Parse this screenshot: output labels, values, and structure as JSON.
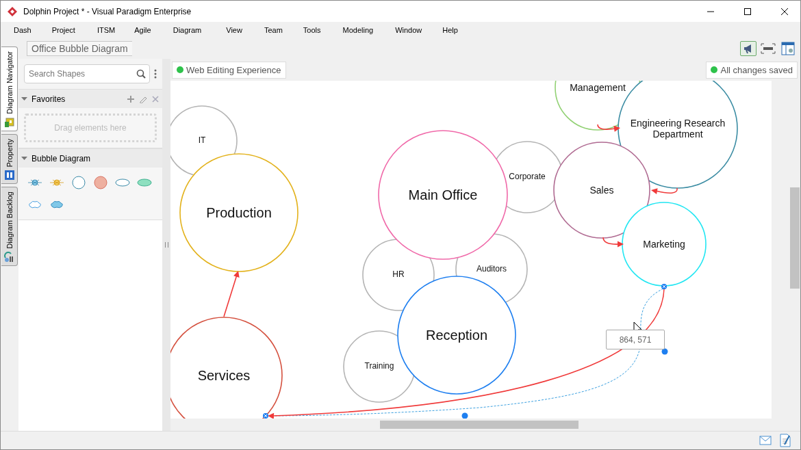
{
  "window": {
    "title": "Dolphin Project * - Visual Paradigm Enterprise"
  },
  "menu": [
    "Dash",
    "Project",
    "ITSM",
    "Agile",
    "Diagram",
    "View",
    "Team",
    "Tools",
    "Modeling",
    "Window",
    "Help"
  ],
  "side_tabs": [
    {
      "label": "Diagram Navigator",
      "selected": true
    },
    {
      "label": "Property",
      "selected": false
    },
    {
      "label": "Diagram Backlog",
      "selected": false
    }
  ],
  "breadcrumb": "Office Bubble Diagram",
  "shape_panel": {
    "search": {
      "placeholder": "Search Shapes"
    },
    "sections": [
      {
        "kind": "favorites",
        "title": "Favorites",
        "expanded": true,
        "hint": "Drag elements here"
      },
      {
        "kind": "shapes",
        "title": "Bubble Diagram",
        "expanded": true
      }
    ]
  },
  "canvas": {
    "edit_badge": "Web Editing Experience",
    "save_status": "All changes saved",
    "bubbles": [
      {
        "label": "IT",
        "color": "#b4b4b4"
      },
      {
        "label": "Production",
        "color": "#e3b21c"
      },
      {
        "label": "Services",
        "color": "#d4503e"
      },
      {
        "label": "Corporate",
        "color": "#b4b4b4"
      },
      {
        "label": "HR",
        "color": "#b4b4b4"
      },
      {
        "label": "Auditors",
        "color": "#b4b4b4"
      },
      {
        "label": "Training",
        "color": "#b4b4b4"
      },
      {
        "label": "Main Office",
        "color": "#f069a9"
      },
      {
        "label": "Reception",
        "color": "#1e7ff0"
      },
      {
        "label": "Management",
        "color": "#92d174"
      },
      {
        "label": "Engineering Research Department",
        "color": "#3b8ca3"
      },
      {
        "label": "Sales",
        "color": "#b06b92"
      },
      {
        "label": "Marketing",
        "color": "#22e6f2"
      }
    ],
    "tooltip": "864, 571"
  }
}
